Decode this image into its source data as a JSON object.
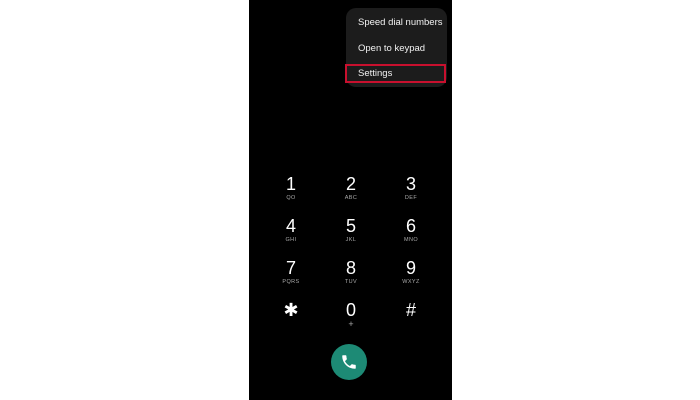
{
  "menu": {
    "items": [
      {
        "label": "Speed dial numbers"
      },
      {
        "label": "Open to keypad"
      },
      {
        "label": "Settings"
      }
    ],
    "highlighted_item": "Settings",
    "highlight_color": "#c8102e"
  },
  "keypad": {
    "keys": [
      {
        "digit": "1",
        "letters": "QO"
      },
      {
        "digit": "2",
        "letters": "ABC"
      },
      {
        "digit": "3",
        "letters": "DEF"
      },
      {
        "digit": "4",
        "letters": "GHI"
      },
      {
        "digit": "5",
        "letters": "JKL"
      },
      {
        "digit": "6",
        "letters": "MNO"
      },
      {
        "digit": "7",
        "letters": "PQRS"
      },
      {
        "digit": "8",
        "letters": "TUV"
      },
      {
        "digit": "9",
        "letters": "WXYZ"
      },
      {
        "digit": "✱",
        "letters": ""
      },
      {
        "digit": "0",
        "letters": "+"
      },
      {
        "digit": "#",
        "letters": ""
      }
    ]
  },
  "call_button": {
    "icon": "phone-icon",
    "color": "#1d8a75"
  },
  "colors": {
    "screen_background": "#000000",
    "menu_background": "#1c1c1c"
  }
}
